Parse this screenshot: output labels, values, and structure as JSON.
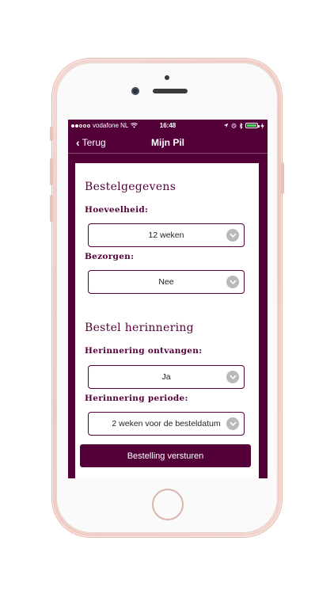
{
  "status_bar": {
    "carrier": "vodafone NL",
    "time": "16:48",
    "signal_bars_filled": 2,
    "signal_bars_total": 5,
    "battery_level": 1.0,
    "battery_color": "#4cd964"
  },
  "nav": {
    "back_label": "Terug",
    "title": "Mijn Pil"
  },
  "order": {
    "section_title": "Bestelgegevens",
    "quantity_label": "Hoeveelheid:",
    "quantity_value": "12 weken",
    "delivery_label": "Bezorgen:",
    "delivery_value": "Nee"
  },
  "reminder": {
    "section_title": "Bestel herinnering",
    "receive_label": "Herinnering ontvangen:",
    "receive_value": "Ja",
    "period_label": "Herinnering periode:",
    "period_value": "2 weken voor de besteldatum"
  },
  "submit_label": "Bestelling versturen",
  "colors": {
    "brand": "#540038",
    "chevron_bg": "#b9b9b9"
  }
}
